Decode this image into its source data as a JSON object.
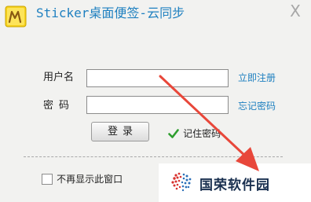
{
  "window": {
    "title": "Sticker桌面便签-云同步",
    "close_glyph": "X"
  },
  "form": {
    "username_label": "用户名",
    "password_label": "密码",
    "username_value": "",
    "password_value": "",
    "register_link": "立即注册",
    "forgot_link": "忘记密码",
    "login_button": "登录",
    "remember_label": "记住密码",
    "remember_checked": true
  },
  "footer": {
    "no_show_label": "不再显示此窗口",
    "no_show_checked": false
  },
  "watermark": {
    "text": "国荣软件园"
  },
  "colors": {
    "accent": "#1f80c0",
    "check_green": "#2e9e2e",
    "arrow_red": "#e8473a"
  }
}
